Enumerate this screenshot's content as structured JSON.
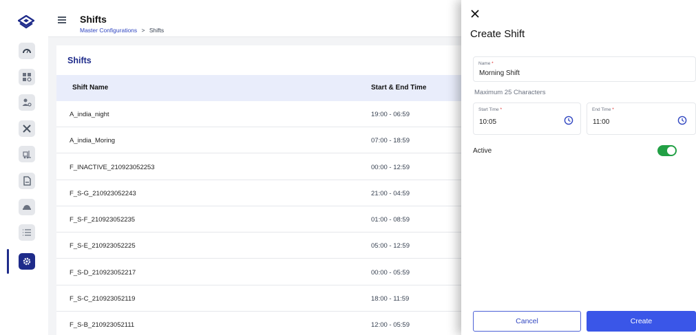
{
  "sidebar": {
    "items": [
      {
        "icon": "dashboard-gauge-icon"
      },
      {
        "icon": "widgets-settings-icon"
      },
      {
        "icon": "user-settings-icon"
      },
      {
        "icon": "tools-icon"
      },
      {
        "icon": "forklift-icon"
      },
      {
        "icon": "document-icon"
      },
      {
        "icon": "helmet-icon"
      },
      {
        "icon": "list-icon"
      },
      {
        "icon": "gear-icon",
        "active": true
      }
    ],
    "accent_color": "#1e2b8a"
  },
  "header": {
    "title": "Shifts",
    "breadcrumb": {
      "parent": "Master Configurations",
      "separator": ">",
      "current": "Shifts"
    }
  },
  "table": {
    "title": "Shifts",
    "columns": [
      "Shift Name",
      "Start & End Time"
    ],
    "rows": [
      {
        "name": "A_india_night",
        "time": "19:00 - 06:59"
      },
      {
        "name": "A_india_Moring",
        "time": "07:00 - 18:59"
      },
      {
        "name": "F_INACTIVE_210923052253",
        "time": "00:00 - 12:59"
      },
      {
        "name": "F_S-G_210923052243",
        "time": "21:00 - 04:59"
      },
      {
        "name": "F_S-F_210923052235",
        "time": "01:00 - 08:59"
      },
      {
        "name": "F_S-E_210923052225",
        "time": "05:00 - 12:59"
      },
      {
        "name": "F_S-D_210923052217",
        "time": "00:00 - 05:59"
      },
      {
        "name": "F_S-C_210923052119",
        "time": "18:00 - 11:59"
      },
      {
        "name": "F_S-B_210923052111",
        "time": "12:00 - 05:59"
      }
    ]
  },
  "drawer": {
    "title": "Create Shift",
    "name_field": {
      "label": "Name",
      "required_mark": "*",
      "value": "Morning Shift"
    },
    "hint": "Maximum 25 Characters",
    "start_time": {
      "label": "Start Time",
      "required_mark": "*",
      "value": "10:05"
    },
    "end_time": {
      "label": "End Time",
      "required_mark": "*",
      "value": "11:00"
    },
    "active": {
      "label": "Active",
      "enabled": true
    },
    "cancel_label": "Cancel",
    "create_label": "Create",
    "colors": {
      "primary": "#3a56e8",
      "toggle_on": "#22a045",
      "required": "#dc2626"
    }
  }
}
